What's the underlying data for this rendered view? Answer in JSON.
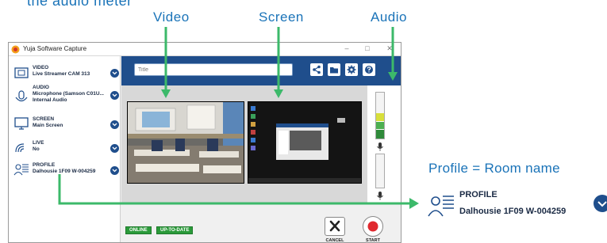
{
  "annotations": {
    "cut_top_text": "the audio meter",
    "video_label": "Video",
    "screen_label": "Screen",
    "audio_label": "Audio",
    "profile_caption": "Profile = Room name"
  },
  "window": {
    "title": "Yuja Software Capture",
    "controls": [
      "–",
      "□",
      "✕"
    ]
  },
  "sidebar": {
    "items": [
      {
        "category": "VIDEO",
        "lines": [
          "Live Streamer CAM 313"
        ],
        "icon": "camera-icon"
      },
      {
        "category": "AUDIO",
        "lines": [
          "Microphone (Samson C01U...",
          "Internal Audio"
        ],
        "icon": "microphone-icon"
      },
      {
        "category": "SCREEN",
        "lines": [
          "Main Screen"
        ],
        "icon": "monitor-icon"
      },
      {
        "category": "LIVE",
        "lines": [
          "No"
        ],
        "icon": "broadcast-icon"
      },
      {
        "category": "PROFILE",
        "lines": [
          "Dalhousie 1F09 W-004259"
        ],
        "icon": "profile-icon"
      }
    ]
  },
  "toolbar": {
    "title_placeholder": "Title",
    "buttons": [
      "share-icon",
      "folder-icon",
      "gear-icon",
      "help-icon"
    ]
  },
  "status": {
    "online": "ONLINE",
    "update": "UP-TO-DATE"
  },
  "actions": {
    "cancel": "CANCEL",
    "start": "START"
  },
  "audio_meters": {
    "mic1_level": 0.55,
    "mic2_level": 0.0
  },
  "callout": {
    "category": "PROFILE",
    "value": "Dalhousie 1F09 W-004259"
  },
  "colors": {
    "accent_blue": "#1f4e8c",
    "annotation_blue": "#1a73b8",
    "arrow_green": "#3cb96a",
    "status_green": "#2b9a3a",
    "record_red": "#e0282e"
  }
}
